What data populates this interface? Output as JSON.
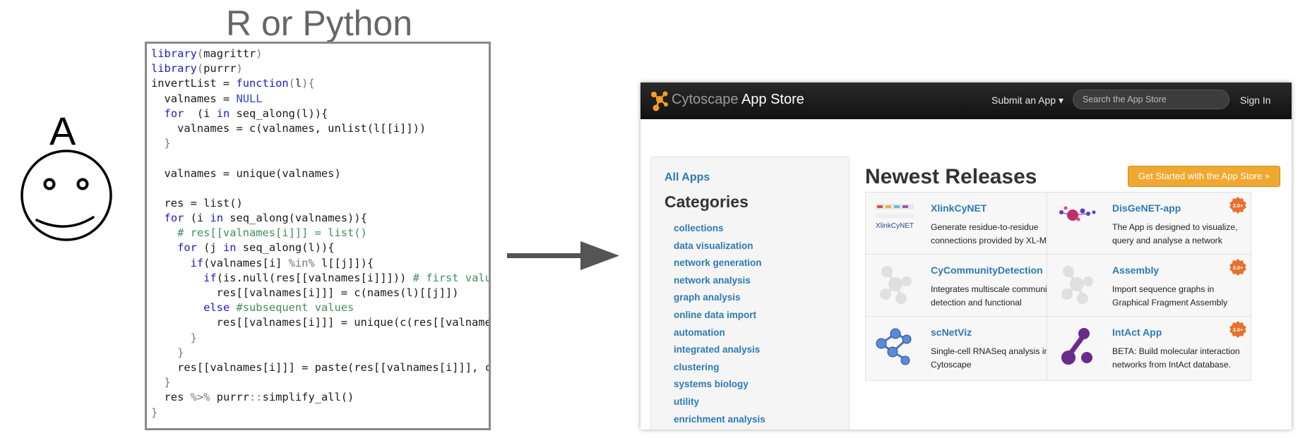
{
  "person": {
    "letter": "A"
  },
  "code_panel": {
    "title": "R or Python",
    "lines": [
      [
        [
          "kw",
          "library"
        ],
        [
          "op",
          "("
        ],
        [
          "",
          "magrittr"
        ],
        [
          "op",
          ")"
        ]
      ],
      [
        [
          "kw",
          "library"
        ],
        [
          "op",
          "("
        ],
        [
          "",
          "purrr"
        ],
        [
          "op",
          ")"
        ]
      ],
      [
        [
          "",
          "invertList = "
        ],
        [
          "kw",
          "function"
        ],
        [
          "op",
          "("
        ],
        [
          "",
          "l"
        ],
        [
          "op",
          "){"
        ]
      ],
      [
        [
          "",
          "  valnames = "
        ],
        [
          "nl",
          "NULL"
        ]
      ],
      [
        [
          "",
          "  "
        ],
        [
          "kw",
          "for"
        ],
        [
          "",
          "  (i "
        ],
        [
          "kw",
          "in"
        ],
        [
          "",
          " seq_along(l)){"
        ]
      ],
      [
        [
          "",
          "    valnames = c(valnames, unlist(l[[i]]))"
        ]
      ],
      [
        [
          "op",
          "  }"
        ]
      ],
      [
        [
          "",
          ""
        ]
      ],
      [
        [
          "",
          "  valnames = unique(valnames)"
        ]
      ],
      [
        [
          "",
          ""
        ]
      ],
      [
        [
          "",
          "  res = list()"
        ]
      ],
      [
        [
          "",
          "  "
        ],
        [
          "kw",
          "for"
        ],
        [
          "",
          " (i "
        ],
        [
          "kw",
          "in"
        ],
        [
          "",
          " seq_along(valnames)){"
        ]
      ],
      [
        [
          "cm",
          "    # res[[valnames[i]]] = list()"
        ]
      ],
      [
        [
          "",
          "    "
        ],
        [
          "kw",
          "for"
        ],
        [
          "",
          " (j "
        ],
        [
          "kw",
          "in"
        ],
        [
          "",
          " seq_along(l)){"
        ]
      ],
      [
        [
          "",
          "      "
        ],
        [
          "kw",
          "if"
        ],
        [
          "",
          "(valnames[i] "
        ],
        [
          "op",
          "%in%"
        ],
        [
          "",
          " l[[j]]){"
        ]
      ],
      [
        [
          "",
          "        "
        ],
        [
          "kw",
          "if"
        ],
        [
          "",
          "(is.null(res[[valnames[i]]])) "
        ],
        [
          "cm",
          "# first value"
        ]
      ],
      [
        [
          "",
          "          res[[valnames[i]]] = c(names(l)[[j]])"
        ]
      ],
      [
        [
          "",
          "        "
        ],
        [
          "kw",
          "else"
        ],
        [
          "",
          " "
        ],
        [
          "cm",
          "#subsequent values"
        ]
      ],
      [
        [
          "",
          "          res[[valnames[i]]] = unique(c(res[[valnames"
        ]
      ],
      [
        [
          "op",
          "      }"
        ]
      ],
      [
        [
          "op",
          "    }"
        ]
      ],
      [
        [
          "",
          "    res[[valnames[i]]] = paste(res[[valnames[i]]], co"
        ]
      ],
      [
        [
          "op",
          "  }"
        ]
      ],
      [
        [
          "",
          "  res "
        ],
        [
          "op",
          "%>%"
        ],
        [
          "",
          " purrr"
        ],
        [
          "op",
          "::"
        ],
        [
          "",
          "simplify_all()"
        ]
      ],
      [
        [
          "op",
          "}"
        ]
      ]
    ]
  },
  "app_store": {
    "logo_brand": "Cytoscape",
    "logo_suffix": " App Store",
    "nav": {
      "submit": "Submit an App ▾",
      "search_placeholder": "Search the App Store",
      "sign_in": "Sign In"
    },
    "sidebar": {
      "all_apps": "All Apps",
      "categories_heading": "Categories",
      "categories": [
        "collections",
        "data visualization",
        "network generation",
        "network analysis",
        "graph analysis",
        "online data import",
        "automation",
        "integrated analysis",
        "clustering",
        "systems biology",
        "utility",
        "enrichment analysis"
      ]
    },
    "main": {
      "heading": "Newest Releases",
      "get_started": "Get Started with the App Store »",
      "badge_text": "3.0+",
      "apps": [
        {
          "name": "XlinkCyNET",
          "desc": "Generate residue-to-residue connections provided by XL-MS in",
          "icon": "xlinkcynet-logo",
          "thumb_text": "XlinkCyNET"
        },
        {
          "name": "DisGeNET-app",
          "desc": "The App is designed to visualize, query and analyse a network",
          "icon": "disgenet-network-logo"
        },
        {
          "name": "CyCommunityDetection",
          "desc": "Integrates multiscale community detection and functional",
          "icon": "generic-app-network-icon"
        },
        {
          "name": "Assembly",
          "desc": "Import sequence graphs in Graphical Fragment Assembly",
          "icon": "generic-app-network-icon"
        },
        {
          "name": "scNetViz",
          "desc": "Single-cell RNASeq analysis in Cytoscape",
          "icon": "scnetviz-network-logo"
        },
        {
          "name": "IntAct App",
          "desc": "BETA: Build molecular interaction networks from IntAct database.",
          "icon": "intact-logo"
        }
      ]
    }
  },
  "colors": {
    "keyword": "#1b1bd1",
    "comment": "#3f8f5f",
    "link": "#2e7ab5",
    "button": "#f0a830",
    "badge": "#e8702a",
    "navbar": "#1c1c1c",
    "intact": "#6a2a8c"
  }
}
